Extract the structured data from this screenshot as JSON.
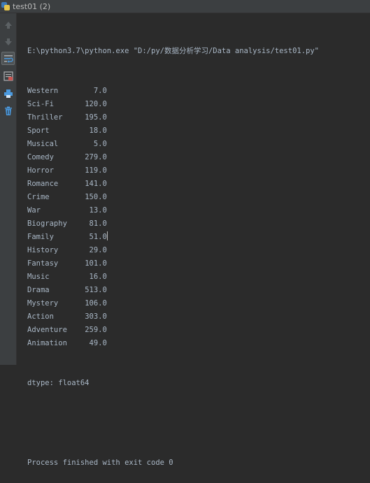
{
  "tab": {
    "title": "test01 (2)",
    "icon": "python-file-icon"
  },
  "toolbar": {
    "buttons": [
      {
        "name": "up-arrow-icon"
      },
      {
        "name": "down-arrow-icon"
      },
      {
        "name": "soft-wrap-icon"
      },
      {
        "name": "scroll-to-end-icon"
      },
      {
        "name": "print-icon"
      },
      {
        "name": "trash-icon"
      }
    ]
  },
  "console": {
    "command": "E:\\python3.7\\python.exe \"D:/py/数据分析学习/Data analysis/test01.py\"",
    "rows": [
      {
        "genre": "Western",
        "value": "7.0"
      },
      {
        "genre": "Sci-Fi",
        "value": "120.0"
      },
      {
        "genre": "Thriller",
        "value": "195.0"
      },
      {
        "genre": "Sport",
        "value": "18.0"
      },
      {
        "genre": "Musical",
        "value": "5.0"
      },
      {
        "genre": "Comedy",
        "value": "279.0"
      },
      {
        "genre": "Horror",
        "value": "119.0"
      },
      {
        "genre": "Romance",
        "value": "141.0"
      },
      {
        "genre": "Crime",
        "value": "150.0"
      },
      {
        "genre": "War",
        "value": "13.0"
      },
      {
        "genre": "Biography",
        "value": "81.0"
      },
      {
        "genre": "Family",
        "value": "51.0"
      },
      {
        "genre": "History",
        "value": "29.0"
      },
      {
        "genre": "Fantasy",
        "value": "101.0"
      },
      {
        "genre": "Music",
        "value": "16.0"
      },
      {
        "genre": "Drama",
        "value": "513.0"
      },
      {
        "genre": "Mystery",
        "value": "106.0"
      },
      {
        "genre": "Action",
        "value": "303.0"
      },
      {
        "genre": "Adventure",
        "value": "259.0"
      },
      {
        "genre": "Animation",
        "value": "49.0"
      }
    ],
    "dtype_line": "dtype: float64",
    "exit_line": "Process finished with exit code 0"
  }
}
